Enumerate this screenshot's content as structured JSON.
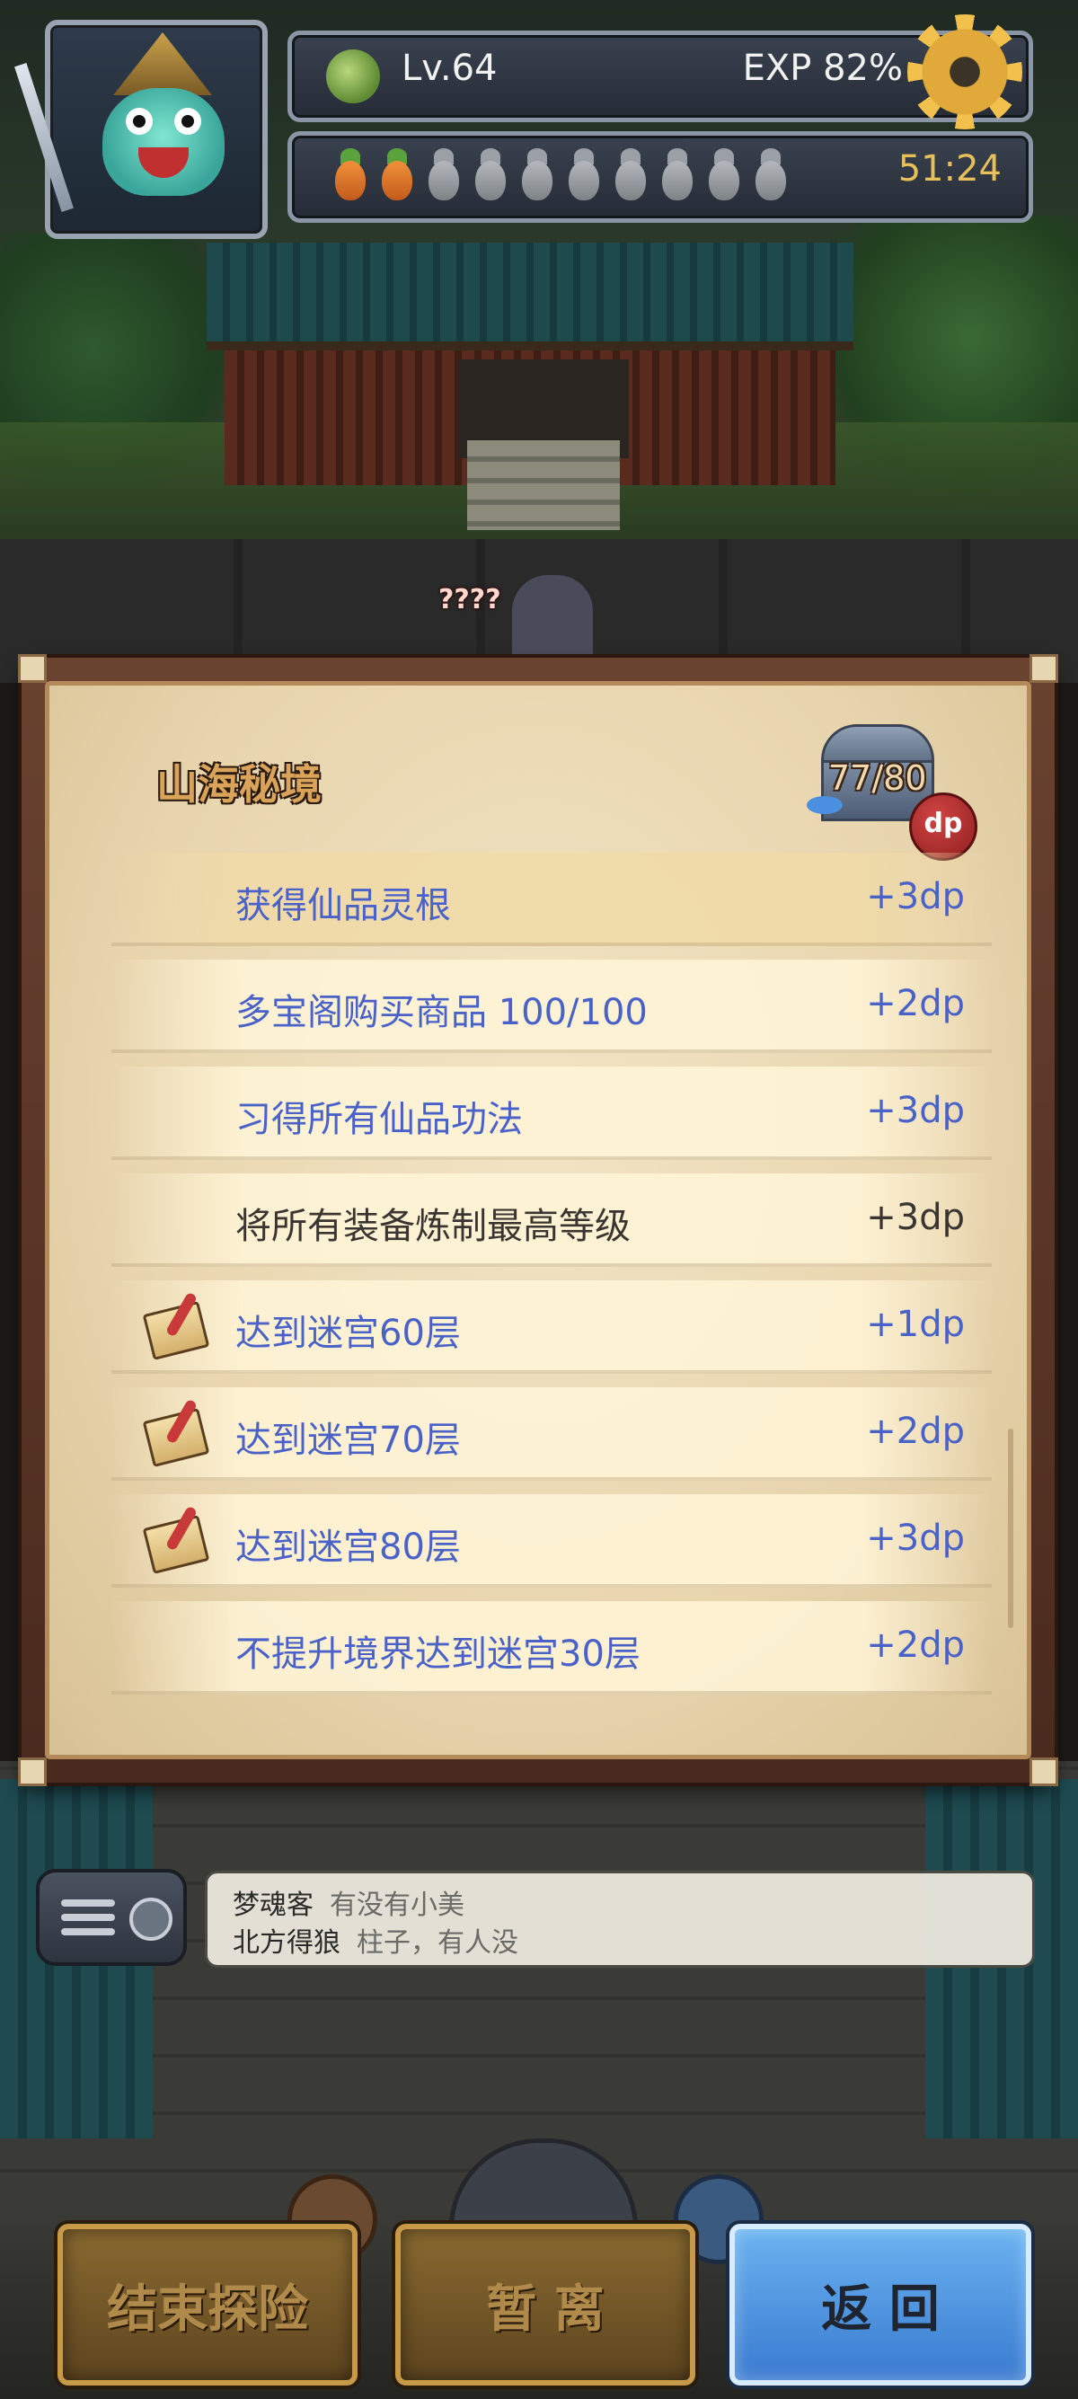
{
  "hud": {
    "level": "Lv.64",
    "exp": "EXP  82%",
    "stamina_full": 2,
    "stamina_total": 10,
    "timer": "51:24"
  },
  "scene": {
    "npc_label": "????"
  },
  "panel": {
    "title": "山海秘境",
    "progress": "77/80",
    "badge": "dp",
    "items": [
      {
        "name": "获得仙品灵根",
        "points": "+3dp",
        "completed": false,
        "has_scroll": false
      },
      {
        "name": "多宝阁购买商品 100/100",
        "points": "+2dp",
        "completed": false,
        "has_scroll": false
      },
      {
        "name": "习得所有仙品功法",
        "points": "+3dp",
        "completed": false,
        "has_scroll": false
      },
      {
        "name": "将所有装备炼制最高等级",
        "points": "+3dp",
        "completed": true,
        "has_scroll": false
      },
      {
        "name": "达到迷宫60层",
        "points": "+1dp",
        "completed": false,
        "has_scroll": true
      },
      {
        "name": "达到迷宫70层",
        "points": "+2dp",
        "completed": false,
        "has_scroll": true
      },
      {
        "name": "达到迷宫80层",
        "points": "+3dp",
        "completed": false,
        "has_scroll": true
      },
      {
        "name": "不提升境界达到迷宫30层",
        "points": "+2dp",
        "completed": false,
        "has_scroll": false
      }
    ]
  },
  "chat": {
    "lines": [
      {
        "user": "梦魂客",
        "message": "有没有小美"
      },
      {
        "user": "北方得狼",
        "message": "柱子，有人没"
      }
    ]
  },
  "buttons": {
    "end": "结束探险",
    "leave": "暂 离",
    "back": "返 回"
  },
  "colors": {
    "item_link": "#4a62c8",
    "item_done": "#3a3530",
    "timer": "#e8c05a",
    "title": "#d9a45a",
    "back_button": "#4a90e0"
  },
  "icons": {
    "settings": "gear-icon",
    "level": "plant-icon",
    "stamina": "carrot-icon",
    "chest": "treasure-chest-icon",
    "task": "scroll-quill-icon",
    "chat": "chat-menu-icon"
  }
}
